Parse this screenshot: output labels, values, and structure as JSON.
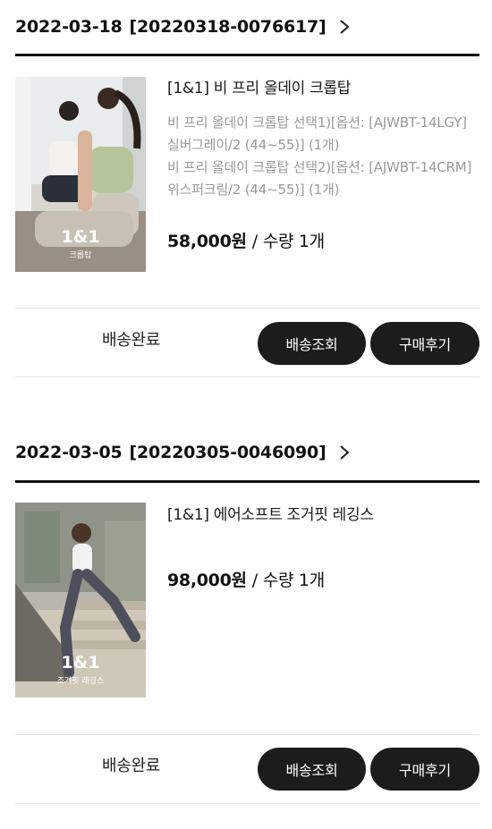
{
  "orders": [
    {
      "date": "2022-03-18",
      "order_number": "[20220318-0076617]",
      "product_name": "[1&1] 비 프리 올데이 크롭탑",
      "options": [
        "비 프리 올데이 크롭탑 선택1)[옵션: [AJWBT-14LGY] 실버그레이/2 (44~55)] (1개)",
        "비 프리 올데이 크롭탑 선택2)[옵션: [AJWBT-14CRM] 위스퍼크림/2 (44~55)] (1개)"
      ],
      "price": "58,000원",
      "separator": "/",
      "quantity": "수량 1개",
      "image_badge_main": "1&1",
      "image_badge_sub": "크롭탑",
      "status": "배송완료",
      "tracking_button": "배송조회",
      "review_button": "구매후기"
    },
    {
      "date": "2022-03-05",
      "order_number": "[20220305-0046090]",
      "product_name": "[1&1] 에어소프트 조거핏 레깅스",
      "options": [],
      "price": "98,000원",
      "separator": "/",
      "quantity": "수량 1개",
      "image_badge_main": "1&1",
      "image_badge_sub": "조거핏 레깅스",
      "status": "배송완료",
      "tracking_button": "배송조회",
      "review_button": "구매후기"
    }
  ],
  "colors": {
    "button_bg": "#1c1c1c",
    "option_text": "#9a9a9a",
    "rule": "#111111"
  }
}
